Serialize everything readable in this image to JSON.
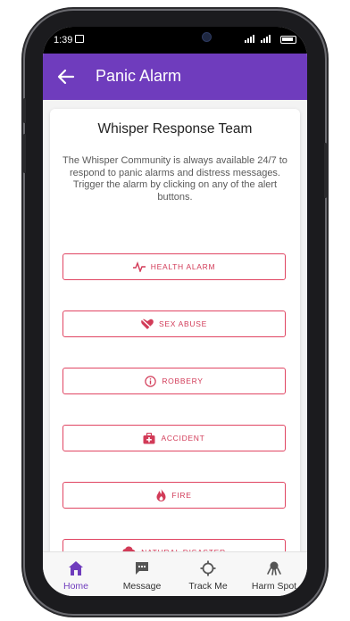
{
  "status_bar": {
    "time": "1:39",
    "signal_text": "ᵢₗₗ.ₗₗ"
  },
  "app_bar": {
    "title": "Panic Alarm"
  },
  "card": {
    "title": "Whisper Response Team",
    "description": "The Whisper Community is always available 24/7 to respond to panic alarms and distress messages. Trigger the alarm by clicking on any of the alert buttons."
  },
  "alarms": [
    {
      "label": "HEALTH ALARM",
      "icon": "heartbeat-icon"
    },
    {
      "label": "SEX ABUSE",
      "icon": "broken-heart-icon"
    },
    {
      "label": "ROBBERY",
      "icon": "info-circle-icon"
    },
    {
      "label": "ACCIDENT",
      "icon": "first-aid-kit-icon"
    },
    {
      "label": "FIRE",
      "icon": "fire-icon"
    },
    {
      "label": "NATURAL DISASTER",
      "icon": "storm-cloud-icon"
    }
  ],
  "bottom_nav": [
    {
      "label": "Home",
      "icon": "home-icon",
      "active": true
    },
    {
      "label": "Message",
      "icon": "chat-icon",
      "active": false
    },
    {
      "label": "Track Me",
      "icon": "crosshair-icon",
      "active": false
    },
    {
      "label": "Harm Spot",
      "icon": "hazard-icon",
      "active": false
    }
  ],
  "colors": {
    "primary": "#6f3cbd",
    "alarm_red": "#e04562"
  }
}
